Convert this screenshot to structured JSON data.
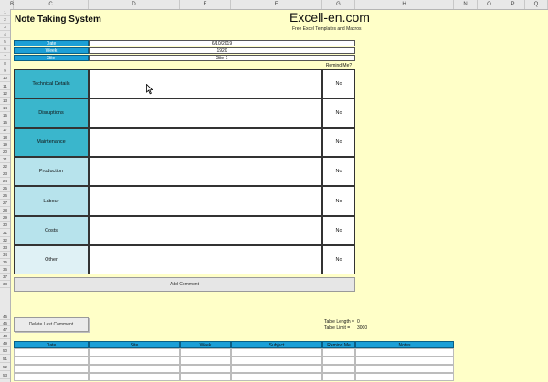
{
  "columns": [
    "B",
    "C",
    "D",
    "E",
    "F",
    "G",
    "H",
    "N",
    "O",
    "P",
    "Q"
  ],
  "rows": [
    "1",
    "2",
    "3",
    "4",
    "5",
    "6",
    "7",
    "8",
    "9",
    "10",
    "11",
    "12",
    "13",
    "14",
    "15",
    "16",
    "17",
    "18",
    "19",
    "20",
    "21",
    "22",
    "23",
    "24",
    "25",
    "26",
    "27",
    "28",
    "29",
    "30",
    "31",
    "32",
    "33",
    "34",
    "35",
    "36",
    "37",
    "38",
    "45",
    "46",
    "47",
    "48",
    "49",
    "50",
    "51",
    "52",
    "53",
    "54"
  ],
  "header": {
    "title": "Note Taking System",
    "logo": "Excell-en.com",
    "tagline": "Free Excel Templates and Macros"
  },
  "info": [
    {
      "label": "Date",
      "value": "6/10/2019"
    },
    {
      "label": "Week",
      "value": "1920"
    },
    {
      "label": "Site",
      "value": "Site 1"
    }
  ],
  "remind_header": "Remind Me?",
  "categories": [
    {
      "label": "Technical Details",
      "remind": "No",
      "color": "#3ab6cc"
    },
    {
      "label": "Disruptions",
      "remind": "No",
      "color": "#3ab6cc"
    },
    {
      "label": "Maintenance",
      "remind": "No",
      "color": "#3ab6cc"
    },
    {
      "label": "Production",
      "remind": "No",
      "color": "#b7e3ec"
    },
    {
      "label": "Labour",
      "remind": "No",
      "color": "#b7e3ec"
    },
    {
      "label": "Costs",
      "remind": "No",
      "color": "#b7e3ec"
    },
    {
      "label": "Other",
      "remind": "No",
      "color": "#dff1f5"
    }
  ],
  "buttons": {
    "add_comment": "Add Comment",
    "delete_last_comment": "Delete Last Comment"
  },
  "stats": [
    {
      "label": "Table Length =",
      "value": "0"
    },
    {
      "label": "Table Limit =",
      "value": "3000"
    }
  ],
  "table": {
    "headers": [
      "Date",
      "Site",
      "Week",
      "Subject",
      "Remind Me",
      "Notes"
    ]
  },
  "colors": {
    "sheet_bg": "#ffffc8",
    "header_blue": "#1b9fd6"
  }
}
